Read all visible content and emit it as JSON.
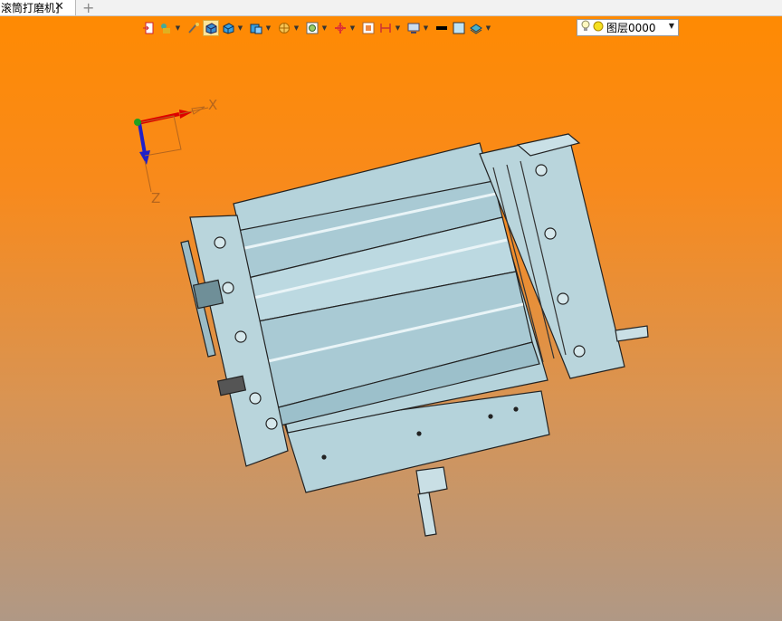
{
  "tab": {
    "title": "滚筒打磨机]",
    "close_label": "✕",
    "add_label": "+"
  },
  "toolbar": {
    "buttons": [
      {
        "name": "insert-icon",
        "has_drop": false
      },
      {
        "name": "paint-bucket-icon",
        "has_drop": true
      },
      {
        "name": "brush-icon",
        "has_drop": false
      },
      {
        "name": "shaded-box-icon",
        "has_drop": false,
        "active": true
      },
      {
        "name": "cube-icon",
        "has_drop": true
      },
      {
        "name": "view-orient-icon",
        "has_drop": true
      },
      {
        "name": "section-icon",
        "has_drop": true
      },
      {
        "name": "zoom-fit-icon",
        "has_drop": true
      },
      {
        "name": "pan-icon",
        "has_drop": true
      },
      {
        "name": "frame-icon",
        "has_drop": false
      },
      {
        "name": "dimension-icon",
        "has_drop": true
      },
      {
        "name": "display-icon",
        "has_drop": true
      },
      {
        "name": "line-color-icon",
        "has_drop": false
      },
      {
        "name": "face-color-icon",
        "has_drop": false
      },
      {
        "name": "layer-style-icon",
        "has_drop": true
      }
    ],
    "layer": {
      "name": "图层0000"
    }
  },
  "axes": {
    "x_label": "X",
    "z_label": "Z"
  },
  "colors": {
    "accent": "#ff8a00",
    "model": "#b5d3db",
    "outline": "#222222"
  }
}
